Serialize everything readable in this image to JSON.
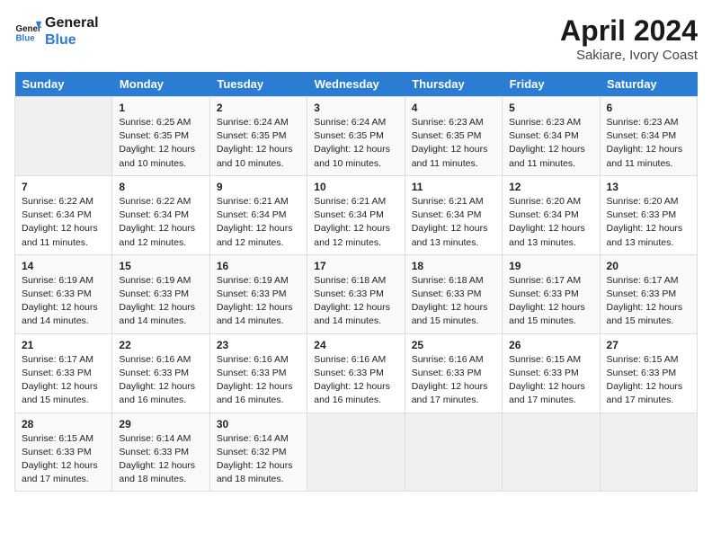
{
  "logo": {
    "line1": "General",
    "line2": "Blue"
  },
  "title": "April 2024",
  "subtitle": "Sakiare, Ivory Coast",
  "days_of_week": [
    "Sunday",
    "Monday",
    "Tuesday",
    "Wednesday",
    "Thursday",
    "Friday",
    "Saturday"
  ],
  "weeks": [
    [
      {
        "day": "",
        "sunrise": "",
        "sunset": "",
        "daylight": ""
      },
      {
        "day": "1",
        "sunrise": "Sunrise: 6:25 AM",
        "sunset": "Sunset: 6:35 PM",
        "daylight": "Daylight: 12 hours and 10 minutes."
      },
      {
        "day": "2",
        "sunrise": "Sunrise: 6:24 AM",
        "sunset": "Sunset: 6:35 PM",
        "daylight": "Daylight: 12 hours and 10 minutes."
      },
      {
        "day": "3",
        "sunrise": "Sunrise: 6:24 AM",
        "sunset": "Sunset: 6:35 PM",
        "daylight": "Daylight: 12 hours and 10 minutes."
      },
      {
        "day": "4",
        "sunrise": "Sunrise: 6:23 AM",
        "sunset": "Sunset: 6:35 PM",
        "daylight": "Daylight: 12 hours and 11 minutes."
      },
      {
        "day": "5",
        "sunrise": "Sunrise: 6:23 AM",
        "sunset": "Sunset: 6:34 PM",
        "daylight": "Daylight: 12 hours and 11 minutes."
      },
      {
        "day": "6",
        "sunrise": "Sunrise: 6:23 AM",
        "sunset": "Sunset: 6:34 PM",
        "daylight": "Daylight: 12 hours and 11 minutes."
      }
    ],
    [
      {
        "day": "7",
        "sunrise": "Sunrise: 6:22 AM",
        "sunset": "Sunset: 6:34 PM",
        "daylight": "Daylight: 12 hours and 11 minutes."
      },
      {
        "day": "8",
        "sunrise": "Sunrise: 6:22 AM",
        "sunset": "Sunset: 6:34 PM",
        "daylight": "Daylight: 12 hours and 12 minutes."
      },
      {
        "day": "9",
        "sunrise": "Sunrise: 6:21 AM",
        "sunset": "Sunset: 6:34 PM",
        "daylight": "Daylight: 12 hours and 12 minutes."
      },
      {
        "day": "10",
        "sunrise": "Sunrise: 6:21 AM",
        "sunset": "Sunset: 6:34 PM",
        "daylight": "Daylight: 12 hours and 12 minutes."
      },
      {
        "day": "11",
        "sunrise": "Sunrise: 6:21 AM",
        "sunset": "Sunset: 6:34 PM",
        "daylight": "Daylight: 12 hours and 13 minutes."
      },
      {
        "day": "12",
        "sunrise": "Sunrise: 6:20 AM",
        "sunset": "Sunset: 6:34 PM",
        "daylight": "Daylight: 12 hours and 13 minutes."
      },
      {
        "day": "13",
        "sunrise": "Sunrise: 6:20 AM",
        "sunset": "Sunset: 6:33 PM",
        "daylight": "Daylight: 12 hours and 13 minutes."
      }
    ],
    [
      {
        "day": "14",
        "sunrise": "Sunrise: 6:19 AM",
        "sunset": "Sunset: 6:33 PM",
        "daylight": "Daylight: 12 hours and 14 minutes."
      },
      {
        "day": "15",
        "sunrise": "Sunrise: 6:19 AM",
        "sunset": "Sunset: 6:33 PM",
        "daylight": "Daylight: 12 hours and 14 minutes."
      },
      {
        "day": "16",
        "sunrise": "Sunrise: 6:19 AM",
        "sunset": "Sunset: 6:33 PM",
        "daylight": "Daylight: 12 hours and 14 minutes."
      },
      {
        "day": "17",
        "sunrise": "Sunrise: 6:18 AM",
        "sunset": "Sunset: 6:33 PM",
        "daylight": "Daylight: 12 hours and 14 minutes."
      },
      {
        "day": "18",
        "sunrise": "Sunrise: 6:18 AM",
        "sunset": "Sunset: 6:33 PM",
        "daylight": "Daylight: 12 hours and 15 minutes."
      },
      {
        "day": "19",
        "sunrise": "Sunrise: 6:17 AM",
        "sunset": "Sunset: 6:33 PM",
        "daylight": "Daylight: 12 hours and 15 minutes."
      },
      {
        "day": "20",
        "sunrise": "Sunrise: 6:17 AM",
        "sunset": "Sunset: 6:33 PM",
        "daylight": "Daylight: 12 hours and 15 minutes."
      }
    ],
    [
      {
        "day": "21",
        "sunrise": "Sunrise: 6:17 AM",
        "sunset": "Sunset: 6:33 PM",
        "daylight": "Daylight: 12 hours and 15 minutes."
      },
      {
        "day": "22",
        "sunrise": "Sunrise: 6:16 AM",
        "sunset": "Sunset: 6:33 PM",
        "daylight": "Daylight: 12 hours and 16 minutes."
      },
      {
        "day": "23",
        "sunrise": "Sunrise: 6:16 AM",
        "sunset": "Sunset: 6:33 PM",
        "daylight": "Daylight: 12 hours and 16 minutes."
      },
      {
        "day": "24",
        "sunrise": "Sunrise: 6:16 AM",
        "sunset": "Sunset: 6:33 PM",
        "daylight": "Daylight: 12 hours and 16 minutes."
      },
      {
        "day": "25",
        "sunrise": "Sunrise: 6:16 AM",
        "sunset": "Sunset: 6:33 PM",
        "daylight": "Daylight: 12 hours and 17 minutes."
      },
      {
        "day": "26",
        "sunrise": "Sunrise: 6:15 AM",
        "sunset": "Sunset: 6:33 PM",
        "daylight": "Daylight: 12 hours and 17 minutes."
      },
      {
        "day": "27",
        "sunrise": "Sunrise: 6:15 AM",
        "sunset": "Sunset: 6:33 PM",
        "daylight": "Daylight: 12 hours and 17 minutes."
      }
    ],
    [
      {
        "day": "28",
        "sunrise": "Sunrise: 6:15 AM",
        "sunset": "Sunset: 6:33 PM",
        "daylight": "Daylight: 12 hours and 17 minutes."
      },
      {
        "day": "29",
        "sunrise": "Sunrise: 6:14 AM",
        "sunset": "Sunset: 6:33 PM",
        "daylight": "Daylight: 12 hours and 18 minutes."
      },
      {
        "day": "30",
        "sunrise": "Sunrise: 6:14 AM",
        "sunset": "Sunset: 6:32 PM",
        "daylight": "Daylight: 12 hours and 18 minutes."
      },
      {
        "day": "",
        "sunrise": "",
        "sunset": "",
        "daylight": ""
      },
      {
        "day": "",
        "sunrise": "",
        "sunset": "",
        "daylight": ""
      },
      {
        "day": "",
        "sunrise": "",
        "sunset": "",
        "daylight": ""
      },
      {
        "day": "",
        "sunrise": "",
        "sunset": "",
        "daylight": ""
      }
    ]
  ]
}
